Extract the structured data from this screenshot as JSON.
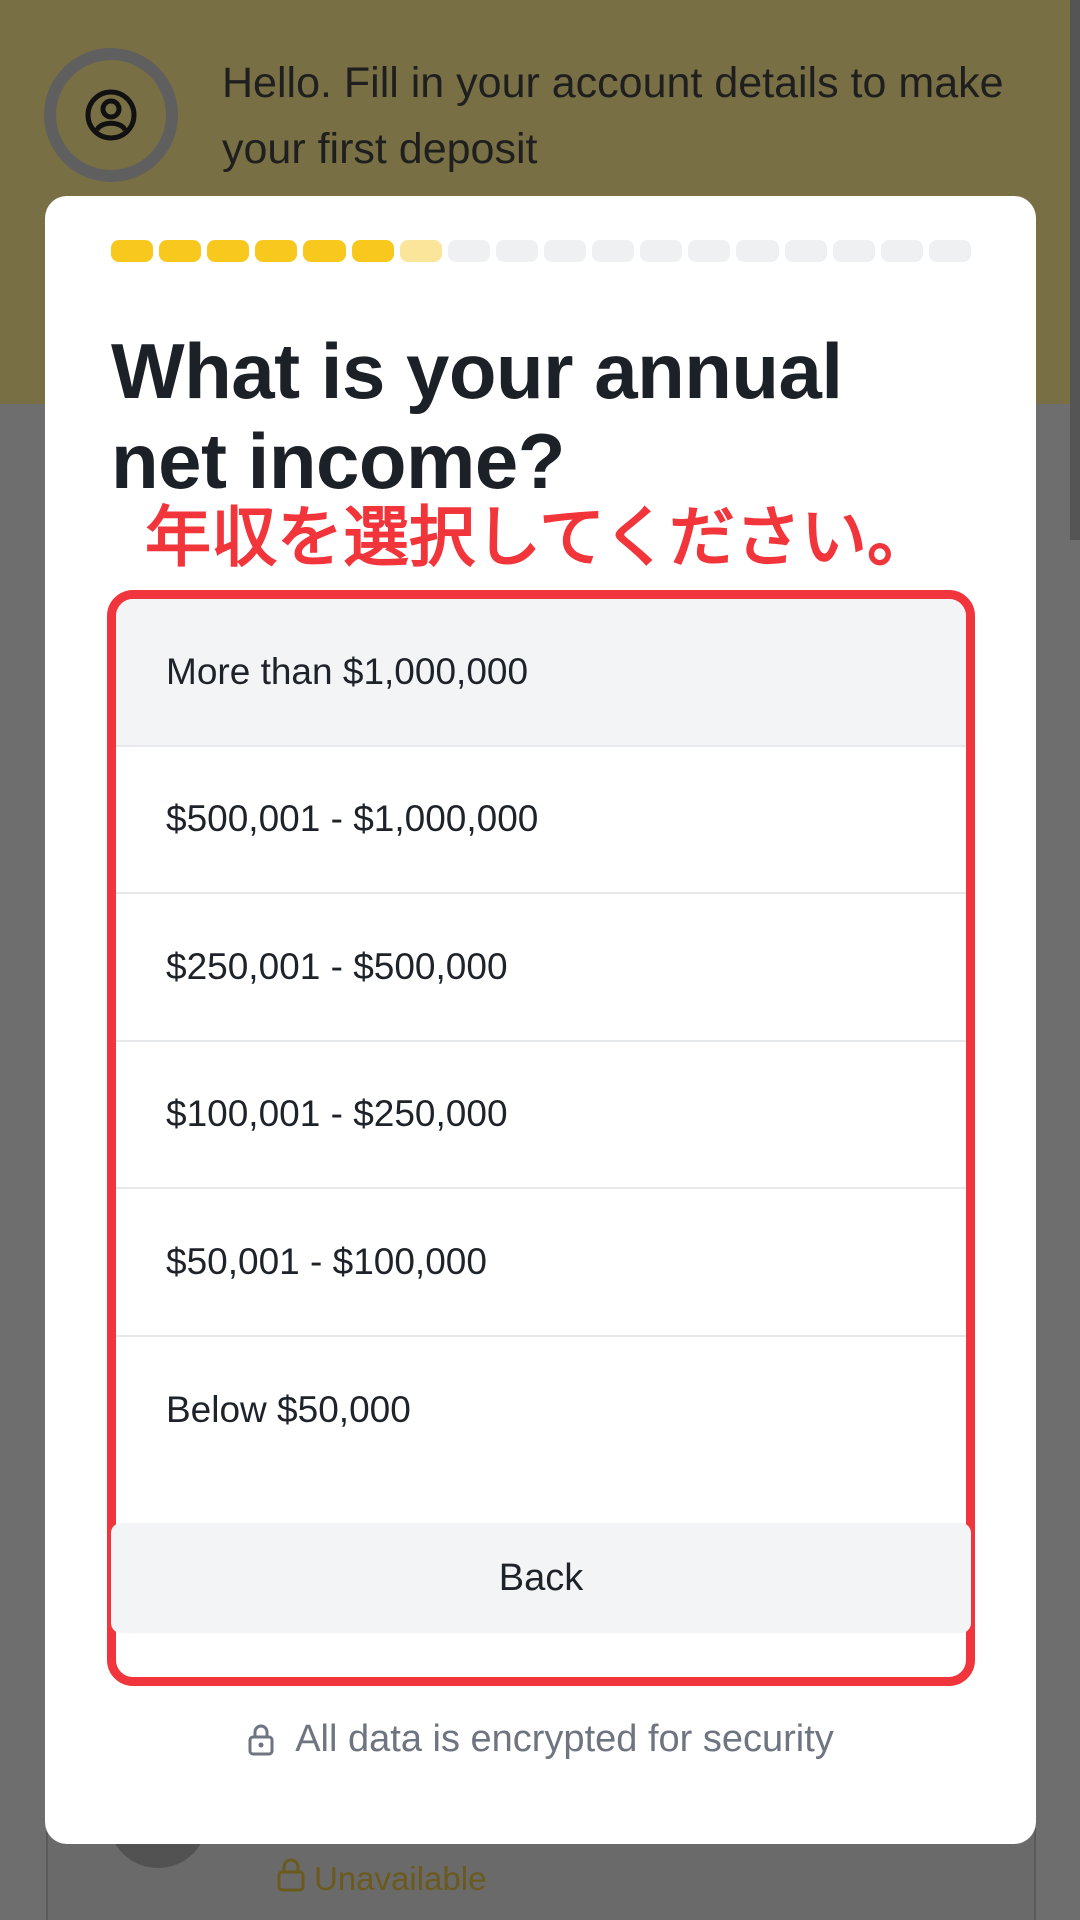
{
  "background": {
    "greeting": "Hello. Fill in your account details to make your first deposit",
    "unavailable_label": "Unavailable"
  },
  "progress": {
    "total_steps": 18,
    "completed_steps": 6,
    "current_step": 7,
    "done_color": "#f8c81e",
    "current_color": "#fbe59a",
    "pending_color": "#eef0f2"
  },
  "question": {
    "title": "What is your annual net income?",
    "annotation": "年収を選択してください。"
  },
  "options": [
    {
      "label": "More than $1,000,000"
    },
    {
      "label": "$500,001 - $1,000,000"
    },
    {
      "label": "$250,001 - $500,000"
    },
    {
      "label": "$100,001 - $250,000"
    },
    {
      "label": "$50,001 - $100,000"
    },
    {
      "label": "Below $50,000"
    }
  ],
  "back_button": {
    "label": "Back"
  },
  "security": {
    "text": "All data is encrypted for security",
    "icon": "lock-icon"
  },
  "colors": {
    "accent": "#f8c81e",
    "annotation": "#f0363c"
  }
}
